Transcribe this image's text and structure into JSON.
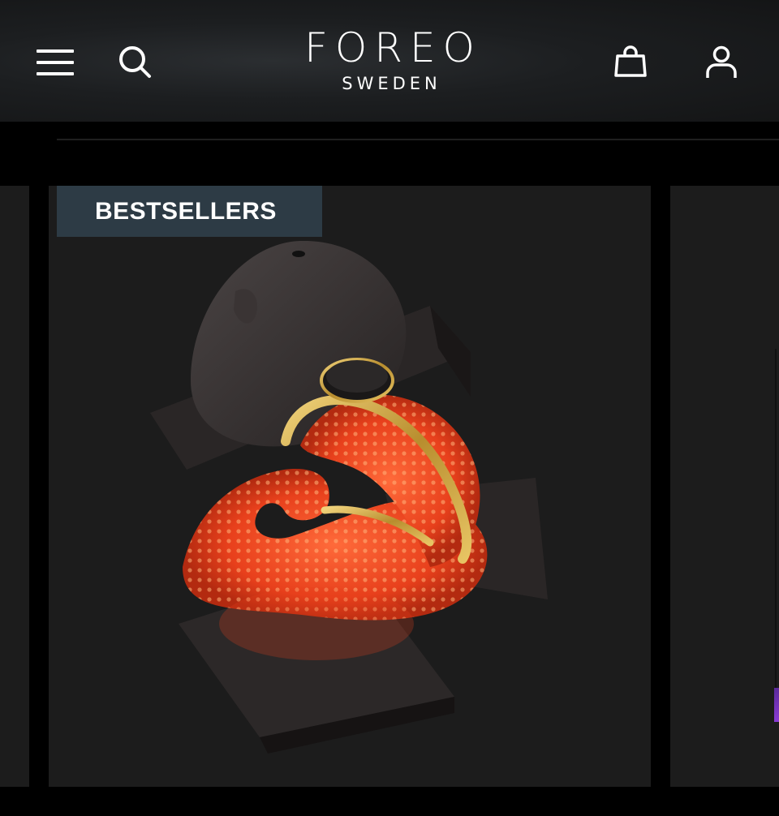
{
  "header": {
    "brand": "FOREO",
    "region": "SWEDEN",
    "menu_icon": "hamburger-menu-icon",
    "search_icon": "search-icon",
    "bag_icon": "shopping-bag-icon",
    "account_icon": "user-account-icon"
  },
  "carousel": {
    "active_card": {
      "badge": "BESTSELLERS",
      "product_image": "led-face-mask-on-stand"
    }
  },
  "colors": {
    "header_bg": "#1c1e20",
    "card_bg": "#1c1c1c",
    "badge_bg": "#2d3b45",
    "mask_glow": "#e8401c"
  }
}
